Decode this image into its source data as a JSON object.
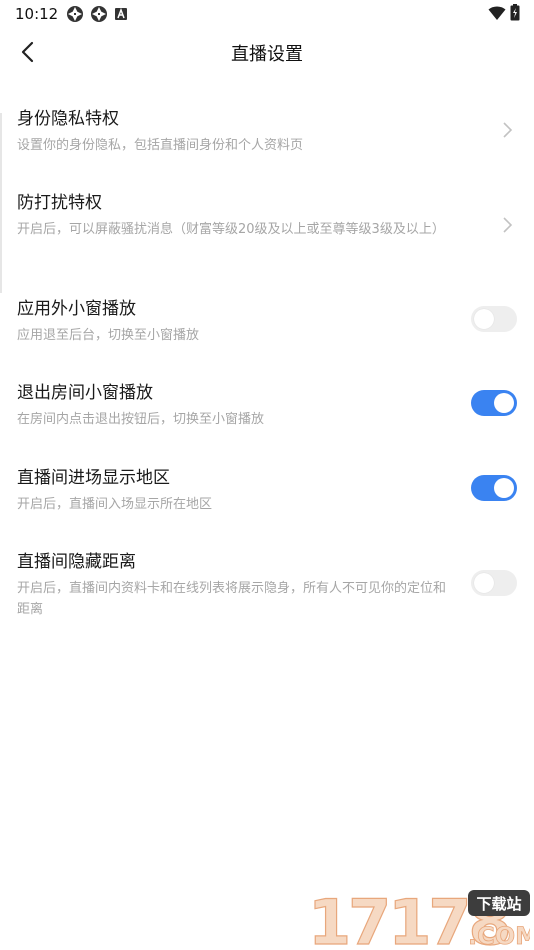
{
  "status_bar": {
    "time": "10:12"
  },
  "header": {
    "title": "直播设置"
  },
  "settings": [
    {
      "title": "身份隐私特权",
      "desc": "设置你的身份隐私，包括直播间身份和个人资料页"
    },
    {
      "title": "防打扰特权",
      "desc": "开启后，可以屏蔽骚扰消息（财富等级20级及以上或至尊等级3级及以上）"
    },
    {
      "title": "应用外小窗播放",
      "desc": "应用退至后台，切换至小窗播放",
      "enabled": false
    },
    {
      "title": "退出房间小窗播放",
      "desc": "在房间内点击退出按钮后，切换至小窗播放",
      "enabled": true
    },
    {
      "title": "直播间进场显示地区",
      "desc": "开启后，直播间入场显示所在地区",
      "enabled": true
    },
    {
      "title": "直播间隐藏距离",
      "desc": "开启后，直播间内资料卡和在线列表将展示隐身，所有人不可见你的定位和距离",
      "enabled": false
    }
  ],
  "colors": {
    "accent": "#3a83f1",
    "toggle_off": "#eeeeee",
    "desc_text": "#a6a6a6"
  },
  "watermark": {
    "number": "17178",
    "badge": "下载站",
    "domain": ".COM"
  }
}
